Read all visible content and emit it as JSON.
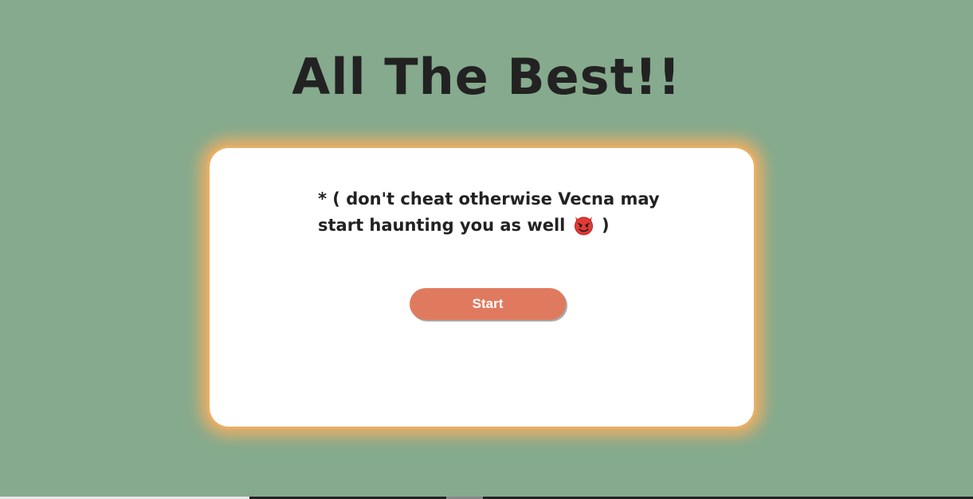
{
  "header": {
    "title": "All The Best!!"
  },
  "card": {
    "warning_text": "* ( don't cheat otherwise Vecna may start haunting you as well",
    "warning_icon": "smiling-devil-icon",
    "warning_close": ")",
    "start_label": "Start"
  },
  "colors": {
    "background": "#85aa8d",
    "card_glow": "#e9ae66",
    "button": "#e07a5f",
    "text": "#222222"
  }
}
